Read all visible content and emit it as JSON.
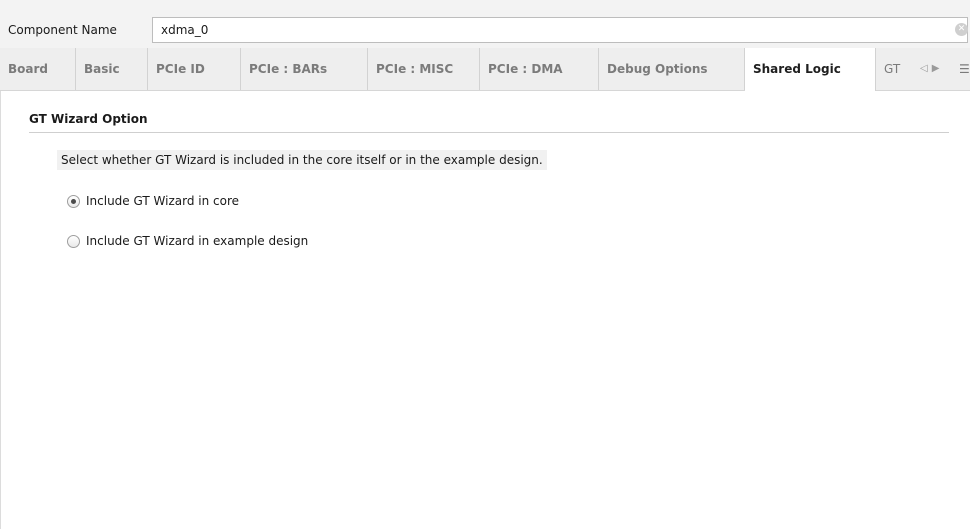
{
  "component": {
    "label": "Component Name",
    "value": "xdma_0",
    "clear_icon": "clear-circle-icon"
  },
  "tabs": [
    {
      "label": "Board",
      "active": false
    },
    {
      "label": "Basic",
      "active": false
    },
    {
      "label": "PCIe ID",
      "active": false
    },
    {
      "label": "PCIe : BARs",
      "active": false
    },
    {
      "label": "PCIe : MISC",
      "active": false
    },
    {
      "label": "PCIe : DMA",
      "active": false
    },
    {
      "label": "Debug Options",
      "active": false
    },
    {
      "label": "Shared Logic",
      "active": true
    },
    {
      "label": "GT",
      "active": false
    }
  ],
  "tab_nav": {
    "left_icon": "triangle-left-icon",
    "right_icon": "triangle-right-icon",
    "menu_icon": "hamburger-menu-icon"
  },
  "section": {
    "title": "GT Wizard Option",
    "description": "Select whether GT Wizard is included in the core itself or in the example design."
  },
  "options": [
    {
      "label": "Include GT Wizard in core",
      "checked": true
    },
    {
      "label": "Include GT Wizard in example design",
      "checked": false
    }
  ]
}
